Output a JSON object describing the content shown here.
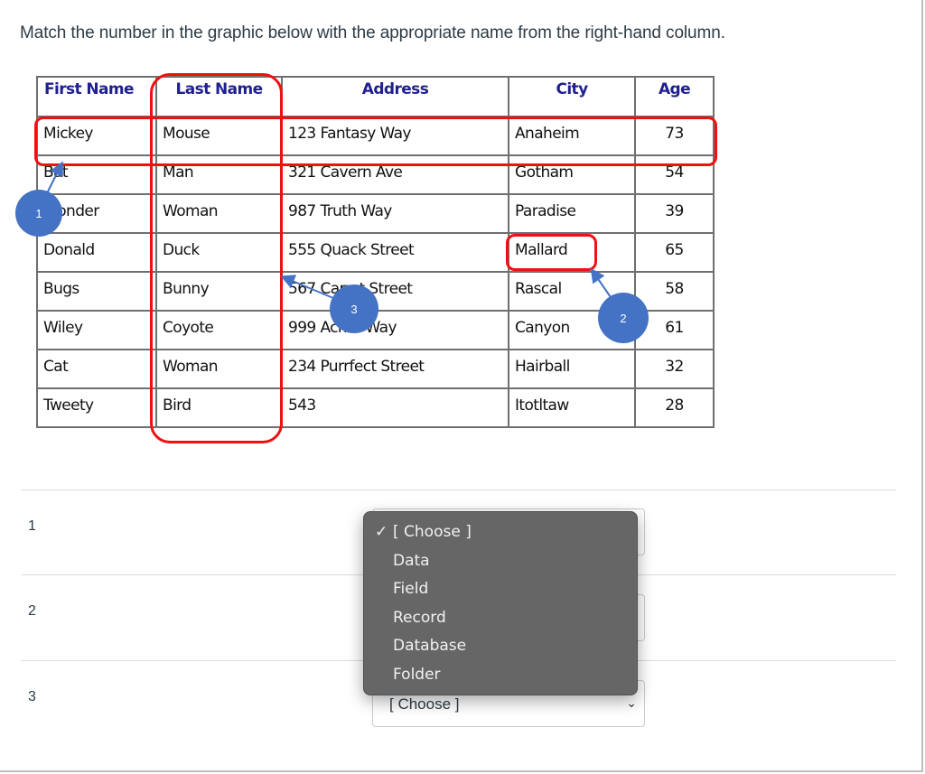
{
  "instruction": "Match the number in the graphic below with the appropriate name from the right-hand column.",
  "graphic": {
    "table": {
      "headers": [
        "First Name",
        "Last Name",
        "Address",
        "City",
        "Age"
      ],
      "rows": [
        [
          "Mickey",
          "Mouse",
          "123 Fantasy Way",
          "Anaheim",
          "73"
        ],
        [
          "Bat",
          "Man",
          "321 Cavern Ave",
          "Gotham",
          "54"
        ],
        [
          "Wonder",
          "Woman",
          "987 Truth Way",
          "Paradise",
          "39"
        ],
        [
          "Donald",
          "Duck",
          "555 Quack Street",
          "Mallard",
          "65"
        ],
        [
          "Bugs",
          "Bunny",
          "567 Carrot Street",
          "Rascal",
          "58"
        ],
        [
          "Wiley",
          "Coyote",
          "999 Acme Way",
          "Canyon",
          "61"
        ],
        [
          "Cat",
          "Woman",
          "234 Purrfect Street",
          "Hairball",
          "32"
        ],
        [
          "Tweety",
          "Bird",
          "543",
          "Itotltaw",
          "28"
        ]
      ]
    },
    "callouts": [
      {
        "number": "1",
        "points_to": "Row: Mickey Mouse record"
      },
      {
        "number": "2",
        "points_to": "Cell: Mallard"
      },
      {
        "number": "3",
        "points_to": "Column: Last Name"
      }
    ],
    "colors": {
      "highlight": "#f01010",
      "callout": "#4472c4",
      "header_text": "#1f1f8f"
    }
  },
  "questions": [
    {
      "label": "1",
      "selected": "[ Choose ]"
    },
    {
      "label": "2",
      "selected": "[ Choose ]"
    },
    {
      "label": "3",
      "selected": "[ Choose ]"
    }
  ],
  "dropdown": {
    "open_for": "1",
    "check_glyph": "✓",
    "options": [
      "[ Choose ]",
      "Data",
      "Field",
      "Record",
      "Database",
      "Folder"
    ],
    "selected_index": 0
  },
  "icons": {
    "chevron": "⌄",
    "check": "check-icon",
    "chevron_name": "chevron-down-icon"
  }
}
